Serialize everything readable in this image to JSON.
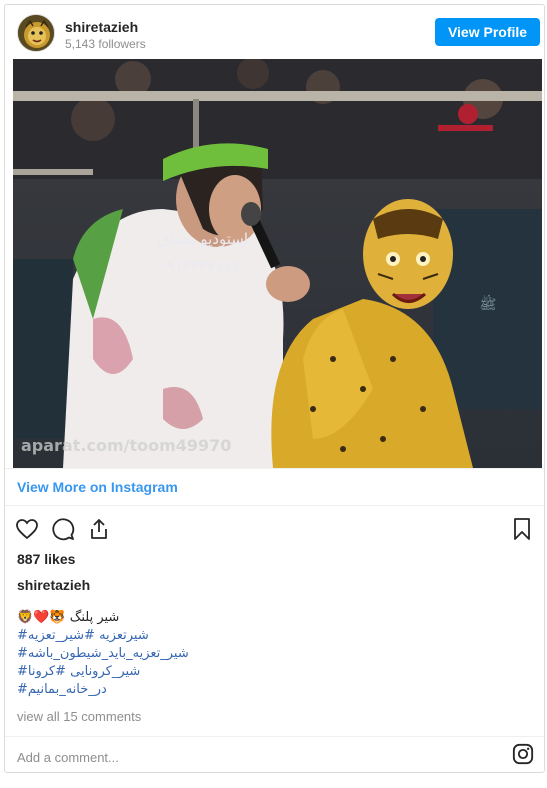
{
  "header": {
    "username": "shiretazieh",
    "followers": "5,143 followers",
    "view_profile_label": "View Profile"
  },
  "media": {
    "description_icon": "video-frame",
    "watermark": "aparat.com/toom49970",
    "overlay_phone": "۰۹۱۳۳۳۷۱۱۷۰",
    "overlay_studio": "استودیو مشاق"
  },
  "links": {
    "view_more": "View More on Instagram"
  },
  "actions": {
    "like_icon": "heart-icon",
    "comment_icon": "comment-icon",
    "share_icon": "share-icon",
    "save_icon": "bookmark-icon"
  },
  "post": {
    "likes": "887 likes",
    "caption_user": "shiretazieh",
    "caption_lines": [
      "🦁❤️🐯 شیر پلنگ",
      "#شیرتعزیه #شیر_تعزیه",
      "#شیر_تعزیه_باید_شیطون_باشه",
      "#شیر_کرونایی #کرونا",
      "#در_خانه_بمانیم"
    ],
    "view_comments": "view all 15 comments"
  },
  "comment_box": {
    "placeholder": "Add a comment...",
    "instagram_icon": "instagram-icon"
  },
  "colors": {
    "accent": "#0095f6",
    "link": "#3897f0",
    "hashtag": "#3566b0",
    "muted": "#8e8e8e",
    "border": "#dbdbdb"
  }
}
